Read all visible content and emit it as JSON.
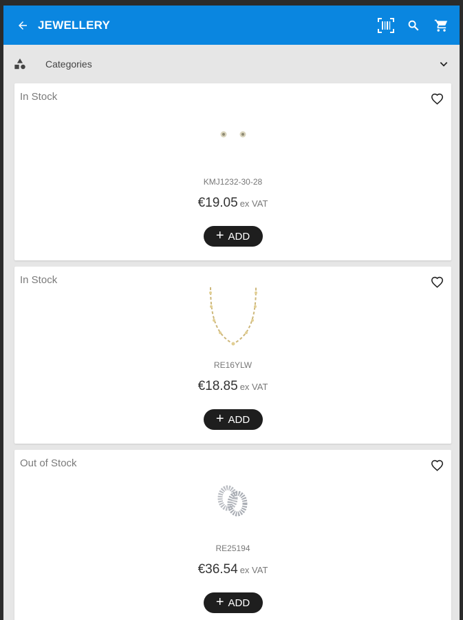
{
  "header": {
    "title": "JEWELLERY",
    "icons": [
      "back-arrow-icon",
      "barcode-scan-icon",
      "search-icon",
      "cart-icon"
    ]
  },
  "categories": {
    "label": "Categories",
    "icon": "categories-icon"
  },
  "colors": {
    "appbar": "#0a86e0",
    "add_button": "#1e1e1e",
    "background": "#e6e6e6"
  },
  "products": [
    {
      "stock": "In Stock",
      "sku": "KMJ1232-30-28",
      "price": "€19.05",
      "vat": "ex VAT",
      "add_label": "ADD",
      "image": "stud-earrings"
    },
    {
      "stock": "In Stock",
      "sku": "RE16YLW",
      "price": "€18.85",
      "vat": "ex VAT",
      "add_label": "ADD",
      "image": "gold-necklace"
    },
    {
      "stock": "Out of Stock",
      "sku": "RE25194",
      "price": "€36.54",
      "vat": "ex VAT",
      "add_label": "ADD",
      "image": "hoop-earrings"
    }
  ]
}
